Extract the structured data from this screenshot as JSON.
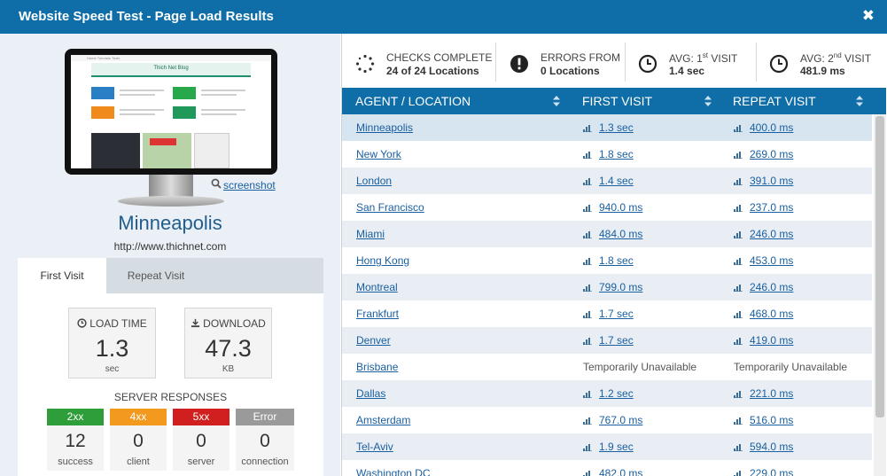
{
  "window": {
    "title": "Website Speed Test - Page Load Results",
    "close_label": "✖"
  },
  "preview": {
    "blog_title": "Thich Net Blog",
    "nav_text": "Home   Tutorials   Tools",
    "screenshot_link": "screenshot"
  },
  "location": {
    "city": "Minneapolis",
    "url": "http://www.thichnet.com"
  },
  "tabs": {
    "first": "First Visit",
    "repeat": "Repeat Visit"
  },
  "stats": {
    "load_time": {
      "label": "LOAD TIME",
      "value": "1.3",
      "unit": "sec"
    },
    "download": {
      "label": "DOWNLOAD",
      "value": "47.3",
      "unit": "KB"
    }
  },
  "server": {
    "heading": "SERVER RESPONSES",
    "items": [
      {
        "code": "2xx",
        "count": "12",
        "caption": "success",
        "color": "#2e9e3a"
      },
      {
        "code": "4xx",
        "count": "0",
        "caption": "client",
        "color": "#f39a1e"
      },
      {
        "code": "5xx",
        "count": "0",
        "caption": "server",
        "color": "#d11f1f"
      },
      {
        "code": "Error",
        "count": "0",
        "caption": "connection",
        "color": "#9a9a9a"
      }
    ]
  },
  "summary": {
    "checks": {
      "line1": "CHECKS COMPLETE",
      "line2": "24 of 24 Locations"
    },
    "errors": {
      "line1": "ERRORS FROM",
      "line2": "0 Locations"
    },
    "avg1": {
      "prefix": "AVG: 1",
      "sup": "st",
      "suffix": " VISIT",
      "line2": "1.4 sec"
    },
    "avg2": {
      "prefix": "AVG: 2",
      "sup": "nd",
      "suffix": " VISIT",
      "line2": "481.9 ms"
    }
  },
  "table": {
    "headers": [
      "AGENT / LOCATION",
      "FIRST VISIT",
      "REPEAT VISIT"
    ],
    "rows": [
      {
        "location": "Minneapolis",
        "first": "1.3 sec",
        "repeat": "400.0 ms"
      },
      {
        "location": "New York",
        "first": "1.8 sec",
        "repeat": "269.0 ms"
      },
      {
        "location": "London",
        "first": "1.4 sec",
        "repeat": "391.0 ms"
      },
      {
        "location": "San Francisco",
        "first": "940.0 ms",
        "repeat": "237.0 ms"
      },
      {
        "location": "Miami",
        "first": "484.0 ms",
        "repeat": "246.0 ms"
      },
      {
        "location": "Hong Kong",
        "first": "1.8 sec",
        "repeat": "453.0 ms"
      },
      {
        "location": "Montreal",
        "first": "799.0 ms",
        "repeat": "246.0 ms"
      },
      {
        "location": "Frankfurt",
        "first": "1.7 sec",
        "repeat": "468.0 ms"
      },
      {
        "location": "Denver",
        "first": "1.7 sec",
        "repeat": "419.0 ms"
      },
      {
        "location": "Brisbane",
        "first": "Temporarily Unavailable",
        "repeat": "Temporarily Unavailable",
        "unavailable": true
      },
      {
        "location": "Dallas",
        "first": "1.2 sec",
        "repeat": "221.0 ms"
      },
      {
        "location": "Amsterdam",
        "first": "767.0 ms",
        "repeat": "516.0 ms"
      },
      {
        "location": "Tel-Aviv",
        "first": "1.9 sec",
        "repeat": "594.0 ms"
      },
      {
        "location": "Washington DC",
        "first": "482.0 ms",
        "repeat": "229.0 ms"
      }
    ]
  }
}
